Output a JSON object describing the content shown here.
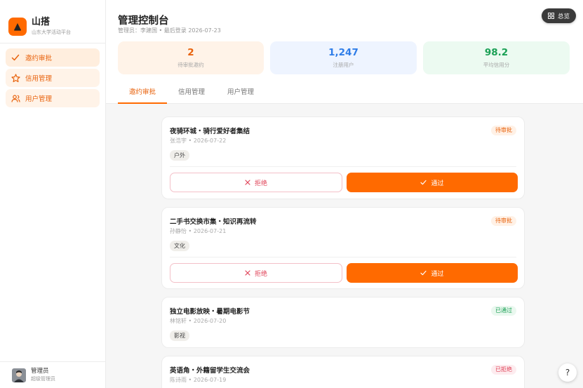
{
  "brand": {
    "name": "山搭",
    "subtitle": "山东大学活动平台",
    "logo_icon": "campfire-icon",
    "logo_color": "#ff6a00"
  },
  "sidebar": {
    "items": [
      {
        "label": "邀约审批",
        "icon": "check-icon",
        "active": true
      },
      {
        "label": "信用管理",
        "icon": "star-icon",
        "active": false
      },
      {
        "label": "用户管理",
        "icon": "users-icon",
        "active": false
      }
    ]
  },
  "user": {
    "name": "管理员",
    "role": "超级管理员"
  },
  "header": {
    "title": "管理控制台",
    "meta": "管理员：李建国 • 最后登录 2026-07-23",
    "overview_label": "总览"
  },
  "stats": [
    {
      "value": "2",
      "label": "待审批邀约",
      "color": "#e8620c",
      "bg": "#fff3e8"
    },
    {
      "value": "1,247",
      "label": "注册用户",
      "color": "#2f7de8",
      "bg": "#eef4ff"
    },
    {
      "value": "98.2",
      "label": "平均信用分",
      "color": "#1aa055",
      "bg": "#ecfaf1"
    }
  ],
  "tabs": [
    {
      "label": "邀约审批",
      "active": true
    },
    {
      "label": "信用管理",
      "active": false
    },
    {
      "label": "用户管理",
      "active": false
    }
  ],
  "invitations": [
    {
      "title": "夜骑环城・骑行爱好者集结",
      "author": "张浩宇",
      "date": "2026-07-22",
      "tag": "户外",
      "status": "待审批",
      "status_color": "#e8620c",
      "status_bg": "#fff1e6"
    },
    {
      "title": "二手书交换市集・知识再流转",
      "author": "孙静怡",
      "date": "2026-07-21",
      "tag": "文化",
      "status": "待审批",
      "status_color": "#e8620c",
      "status_bg": "#fff1e6"
    },
    {
      "title": "独立电影放映・暑期电影节",
      "author": "林铭轩",
      "date": "2026-07-20",
      "tag": "影视",
      "status": "已通过",
      "status_color": "#1aa055",
      "status_bg": "#eaf8ef"
    },
    {
      "title": "英语角・外籍留学生交流会",
      "author": "陈诗雨",
      "date": "2026-07-19",
      "tag": "",
      "status": "已拒绝",
      "status_color": "#e0455a",
      "status_bg": "#fdecef"
    }
  ],
  "actions": {
    "reject_label": "拒绝",
    "approve_label": "通过"
  },
  "help": {
    "label": "?"
  }
}
